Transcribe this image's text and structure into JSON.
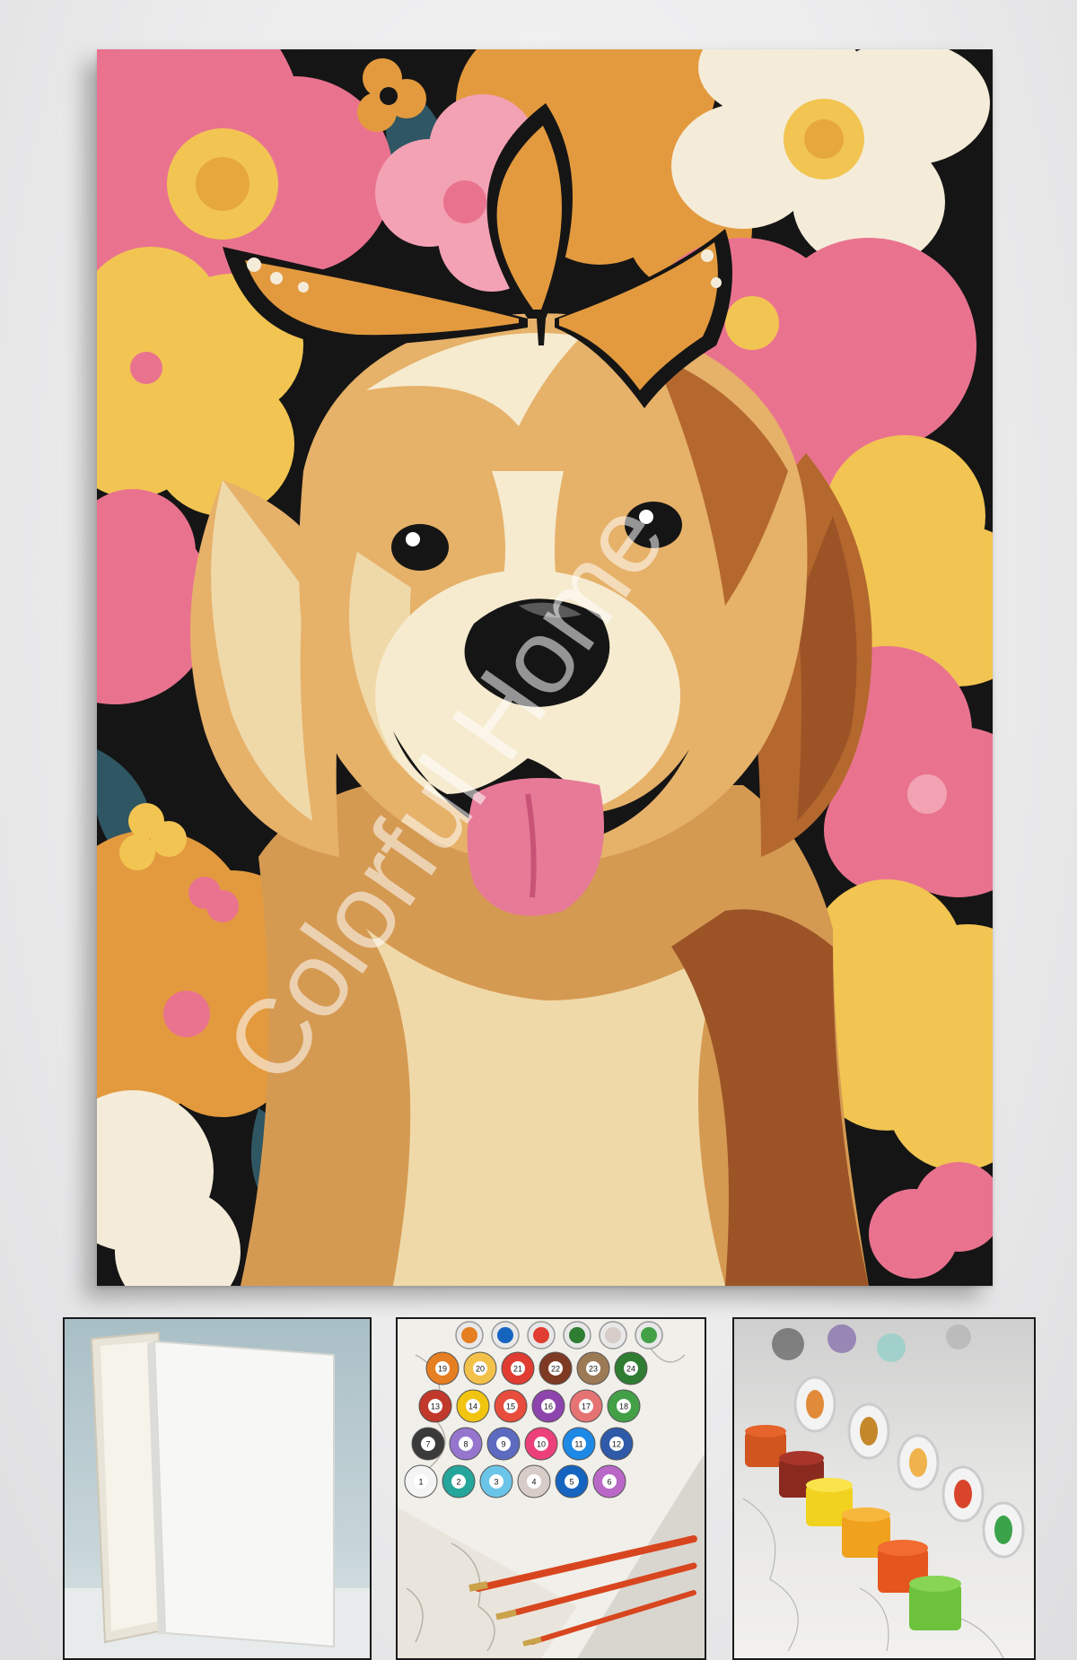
{
  "main_artwork": {
    "subject": "golden retriever with monarch butterfly among flowers",
    "watermark_text": "Colorful Home",
    "colors": {
      "pink": "#e9738f",
      "light_pink": "#f3a2b4",
      "orange": "#e39a3e",
      "yellow": "#f2c552",
      "cream": "#f4ecd9",
      "teal": "#2f5663",
      "dark": "#151515",
      "fur_light": "#f0d9a8",
      "fur_mid": "#d59a52",
      "fur_dark": "#9c5427",
      "tongue": "#e77a97"
    }
  },
  "thumbnails": [
    {
      "name": "blank stretched canvas"
    },
    {
      "name": "numbered paint pots with brushes"
    },
    {
      "name": "open paint pots on outline canvas"
    }
  ],
  "paint_numbers": [
    "19",
    "20",
    "21",
    "22",
    "23",
    "24",
    "13",
    "14",
    "15",
    "16",
    "17",
    "18",
    "7",
    "8",
    "9",
    "10",
    "11",
    "12",
    "1",
    "2",
    "3",
    "4",
    "5",
    "6"
  ]
}
